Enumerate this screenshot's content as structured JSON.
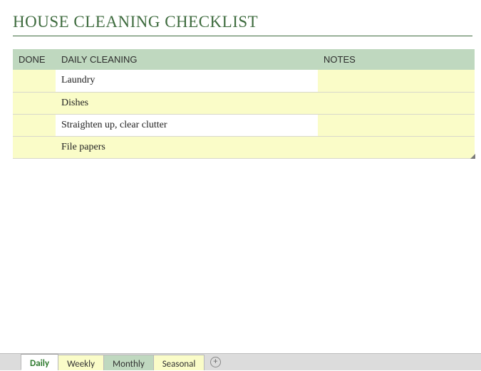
{
  "title": "HOUSE CLEANING CHECKLIST",
  "columns": {
    "done": "DONE",
    "task": "DAILY CLEANING",
    "notes": "NOTES"
  },
  "rows": [
    {
      "done": "",
      "task": "Laundry",
      "notes": ""
    },
    {
      "done": "",
      "task": "Dishes",
      "notes": ""
    },
    {
      "done": "",
      "task": "Straighten up, clear clutter",
      "notes": ""
    },
    {
      "done": "",
      "task": "File papers",
      "notes": ""
    }
  ],
  "tabs": [
    {
      "label": "Daily",
      "style": "active"
    },
    {
      "label": "Weekly",
      "style": "yellow"
    },
    {
      "label": "Monthly",
      "style": "green"
    },
    {
      "label": "Seasonal",
      "style": "yellow"
    }
  ]
}
